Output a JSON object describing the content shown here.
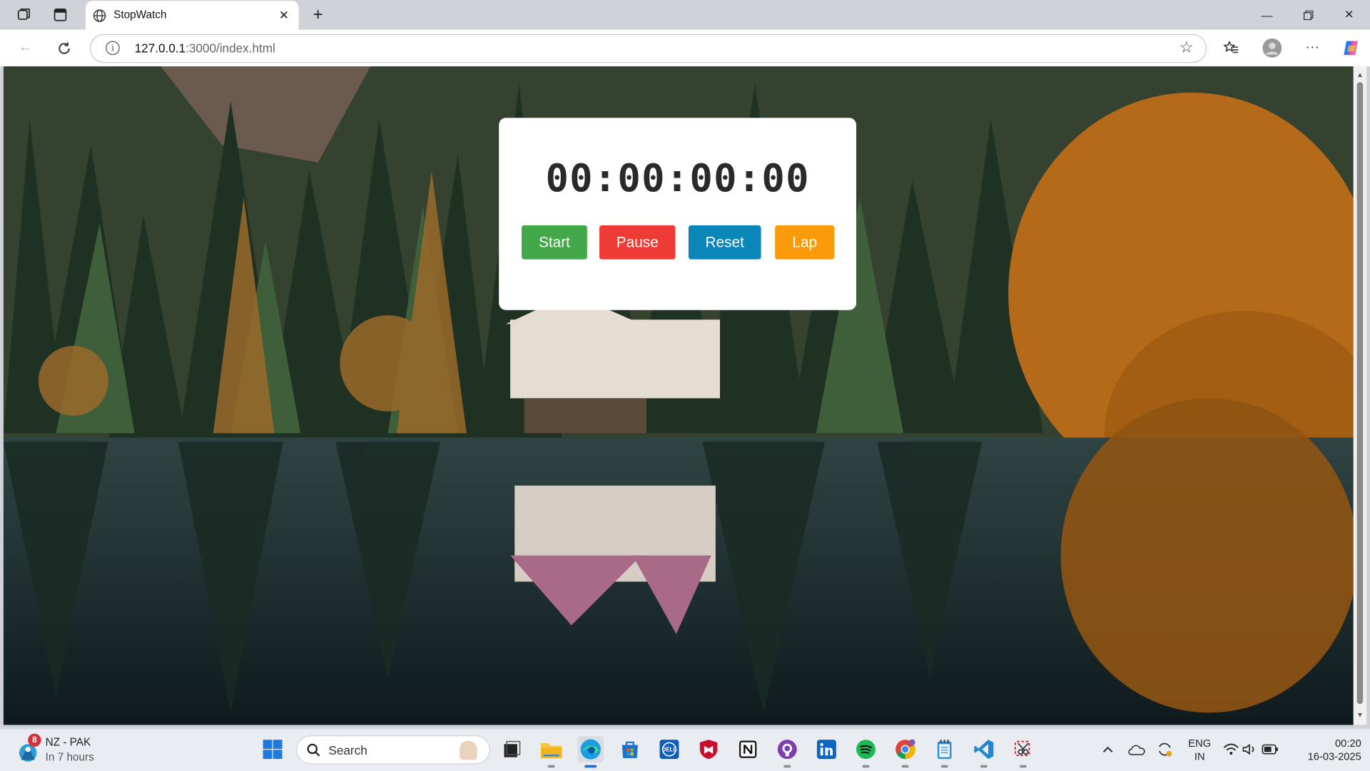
{
  "browser": {
    "tab_title": "StopWatch",
    "url_host": "127.0.0.1",
    "url_path": ":3000/index.html"
  },
  "stopwatch": {
    "time": "00:00:00:00",
    "buttons": {
      "start": "Start",
      "pause": "Pause",
      "reset": "Reset",
      "lap": "Lap"
    },
    "colors": {
      "start": "#43a84a",
      "pause": "#ef3b36",
      "reset": "#0a86b8",
      "lap": "#fb9a0b"
    }
  },
  "taskbar": {
    "weather_title": "NZ - PAK",
    "weather_subtitle": "In 7 hours",
    "weather_badge": "8",
    "search_placeholder": "Search",
    "language_line1": "ENG",
    "language_line2": "IN",
    "clock_time": "00:20",
    "clock_date": "16-03-2025",
    "apps": [
      "task-view",
      "file-explorer",
      "edge",
      "microsoft-store",
      "dell",
      "mcafee",
      "notion",
      "github",
      "linkedin",
      "spotify",
      "chrome",
      "notepad",
      "vscode",
      "snipping-tool"
    ]
  }
}
